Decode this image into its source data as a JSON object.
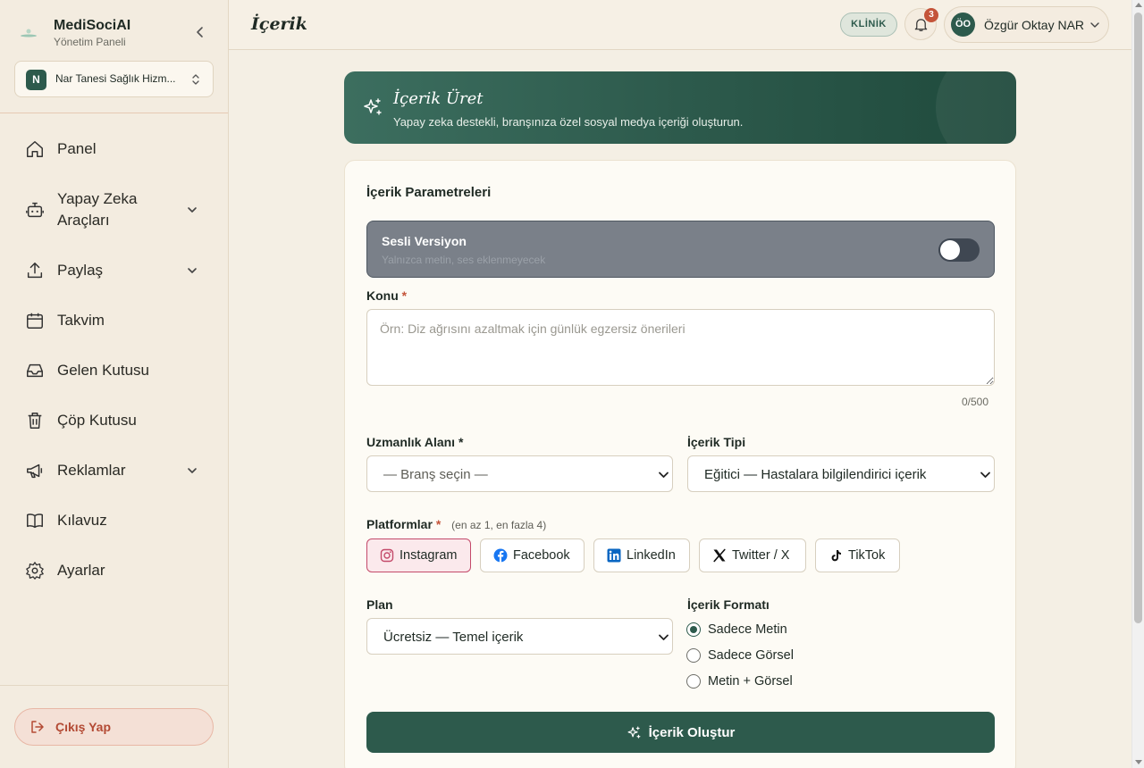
{
  "brand": {
    "name": "MediSociAI",
    "subtitle": "Yönetim Paneli"
  },
  "organization": {
    "initial": "N",
    "name": "Nar Tanesi Sağlık Hizm..."
  },
  "sidebar": {
    "items": [
      {
        "label": "Panel",
        "icon": "home-icon"
      },
      {
        "label": "Yapay Zeka Araçları",
        "icon": "robot-icon",
        "expandable": true
      },
      {
        "label": "Paylaş",
        "icon": "upload-icon",
        "expandable": true
      },
      {
        "label": "Takvim",
        "icon": "calendar-icon"
      },
      {
        "label": "Gelen Kutusu",
        "icon": "inbox-icon"
      },
      {
        "label": "Çöp Kutusu",
        "icon": "trash-icon"
      },
      {
        "label": "Reklamlar",
        "icon": "megaphone-icon",
        "expandable": true
      },
      {
        "label": "Kılavuz",
        "icon": "book-icon"
      },
      {
        "label": "Ayarlar",
        "icon": "gear-icon"
      }
    ],
    "logout_label": "Çıkış Yap"
  },
  "header": {
    "title": "İçerik",
    "role_badge": "KLİNİK",
    "notification_count": "3",
    "user": {
      "initials": "ÖO",
      "name": "Özgür Oktay NAR"
    }
  },
  "hero": {
    "title": "İçerik Üret",
    "subtitle": "Yapay zeka destekli, branşınıza özel sosyal medya içeriği oluşturun."
  },
  "form": {
    "title": "İçerik Parametreleri",
    "voice": {
      "title": "Sesli Versiyon",
      "subtitle": "Yalnızca metin, ses eklenmeyecek",
      "enabled": false
    },
    "topic": {
      "label": "Konu",
      "required_mark": "*",
      "placeholder": "Örn: Diz ağrısını azaltmak için günlük egzersiz önerileri",
      "value": "",
      "counter": "0/500"
    },
    "specialty": {
      "label": "Uzmanlık Alanı *",
      "value": "— Branş seçin —"
    },
    "content_type": {
      "label": "İçerik Tipi",
      "value": "Eğitici — Hastalara bilgilendirici içerik"
    },
    "platforms": {
      "label": "Platformlar",
      "required_mark": "*",
      "hint": "(en az 1, en fazla 4)",
      "items": [
        {
          "label": "Instagram",
          "icon": "instagram-icon",
          "selected": true
        },
        {
          "label": "Facebook",
          "icon": "facebook-icon",
          "selected": false
        },
        {
          "label": "LinkedIn",
          "icon": "linkedin-icon",
          "selected": false
        },
        {
          "label": "Twitter / X",
          "icon": "x-icon",
          "selected": false
        },
        {
          "label": "TikTok",
          "icon": "tiktok-icon",
          "selected": false
        }
      ]
    },
    "plan": {
      "label": "Plan",
      "value": "Ücretsiz — Temel içerik"
    },
    "format": {
      "label": "İçerik Formatı",
      "options": [
        {
          "label": "Sadece Metin",
          "checked": true
        },
        {
          "label": "Sadece Görsel",
          "checked": false
        },
        {
          "label": "Metin + Görsel",
          "checked": false
        }
      ]
    },
    "submit_label": "İçerik Oluştur"
  },
  "colors": {
    "primary": "#2d5a4c",
    "danger": "#c4543a",
    "background": "#f4efe4",
    "card": "#fdfbf5"
  }
}
